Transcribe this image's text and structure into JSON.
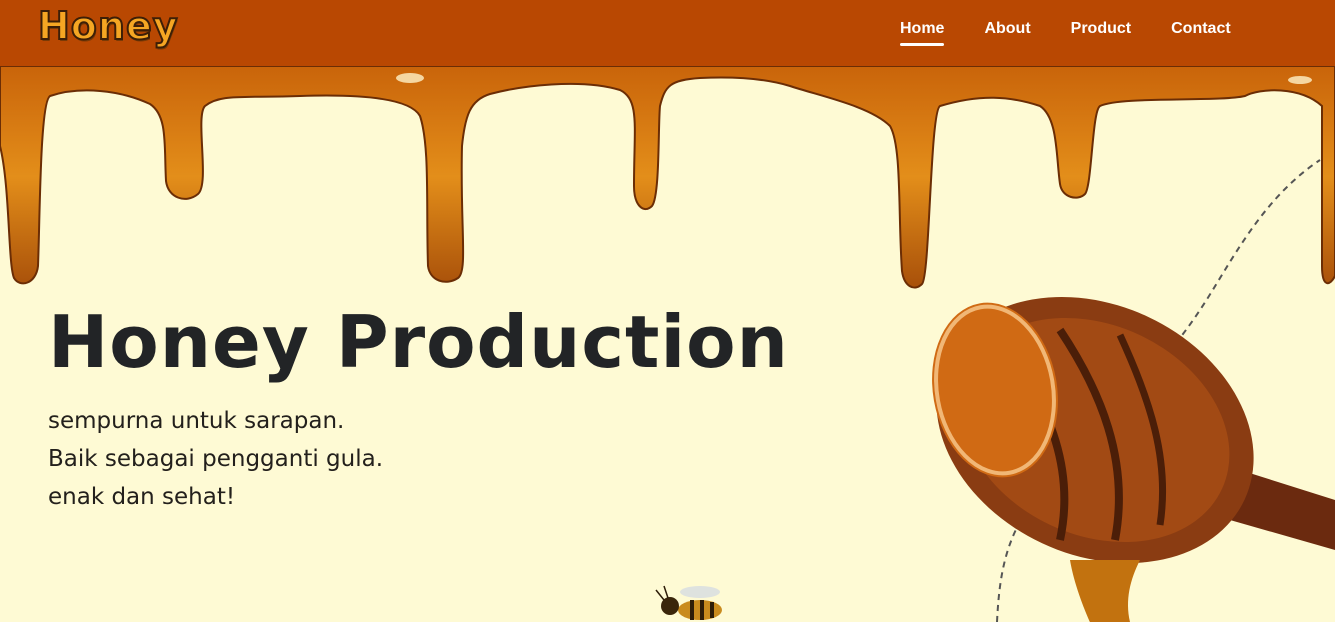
{
  "navbar": {
    "brand": "Honey",
    "links": [
      {
        "label": "Home",
        "active": true
      },
      {
        "label": "About",
        "active": false
      },
      {
        "label": "Product",
        "active": false
      },
      {
        "label": "Contact",
        "active": false
      }
    ]
  },
  "hero": {
    "title": "Honey Production",
    "lines": [
      "sempurna untuk sarapan.",
      "Baik sebagai pengganti gula.",
      "enak dan sehat!"
    ]
  },
  "colors": {
    "navbar": "#b94802",
    "background": "#fefad4",
    "honey": "#d9820f",
    "text": "#222426"
  },
  "icons": {
    "brand": "honey-logo",
    "dipper": "honey-dipper-icon",
    "bee": "bee-icon",
    "drip": "honey-drip-decoration"
  }
}
